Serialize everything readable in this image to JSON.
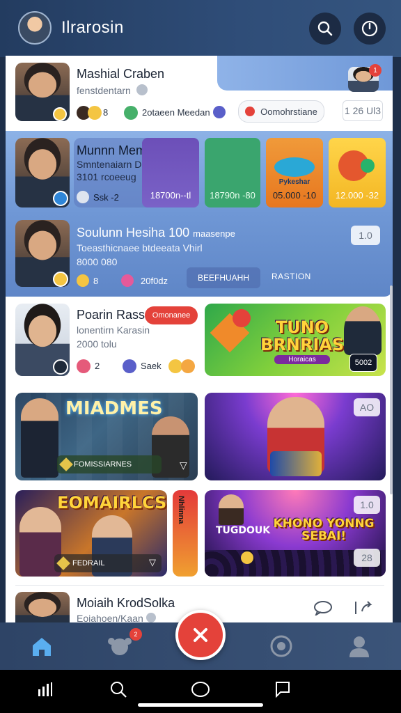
{
  "header": {
    "title": "Ilrarosin",
    "search_icon": "search-icon",
    "power_icon": "power-icon"
  },
  "row1": {
    "name": "Mashial Craben",
    "sub": "fenstdentarn",
    "count": "8",
    "tag": "2otaeen Meedan",
    "pill": "Oomohrstiane",
    "counter": "1 26 Ul3",
    "notif_badge": "1"
  },
  "row2": {
    "name": "Munnn Memasns",
    "line1": "Smntenaiarn Dodennan",
    "line2": "3101 rcoeeug",
    "stat": "Ssk -2",
    "tiles": [
      {
        "label": "18700n--tl"
      },
      {
        "label": "18790n -80"
      },
      {
        "label": "05.000 -10"
      },
      {
        "label": "12.000 -32"
      }
    ],
    "tile3_title": "Pykeshar"
  },
  "row3": {
    "name": "Soulunn Hesiha 100",
    "name_suffix": "maasenpe",
    "line1": "Toeasthicnaee btdeeata Vhirl",
    "line2": "8000 080",
    "stat1": "8",
    "stat2": "20f0dz",
    "btn1": "BEEFHUAHH",
    "btn2": "RASTION",
    "counter": "1.0"
  },
  "row4": {
    "name": "Poarin Rass",
    "red_pill": "Omonanee",
    "line1": "lonentirn Karasin",
    "line2": "2000 tolu",
    "s1": "2",
    "s2": "Saek",
    "game_title": "TUNO BRNRIAS",
    "game_sub": "Horaicas",
    "overlay_badge": "5002"
  },
  "row5": {
    "left_title": "MIADMES",
    "left_label": "FOMISSIARNES",
    "right_counter": "AO"
  },
  "row6": {
    "left_title": "EOMAIRLCS",
    "left_label": "FEDRAIL",
    "strip_text": "Nhlinna",
    "right_title": "KHONO YONNG SEBAI!",
    "right_sub": "TUGDOUK",
    "counter_top": "1.0",
    "counter_bottom": "28"
  },
  "row7": {
    "name": "Moiaih KrodSolka",
    "sub": "Eoiahoen/Kaan"
  },
  "colors": {
    "accent_red": "#e4423a",
    "header_blue": "#2f4d78",
    "row_blue": "#7aa0dd"
  }
}
